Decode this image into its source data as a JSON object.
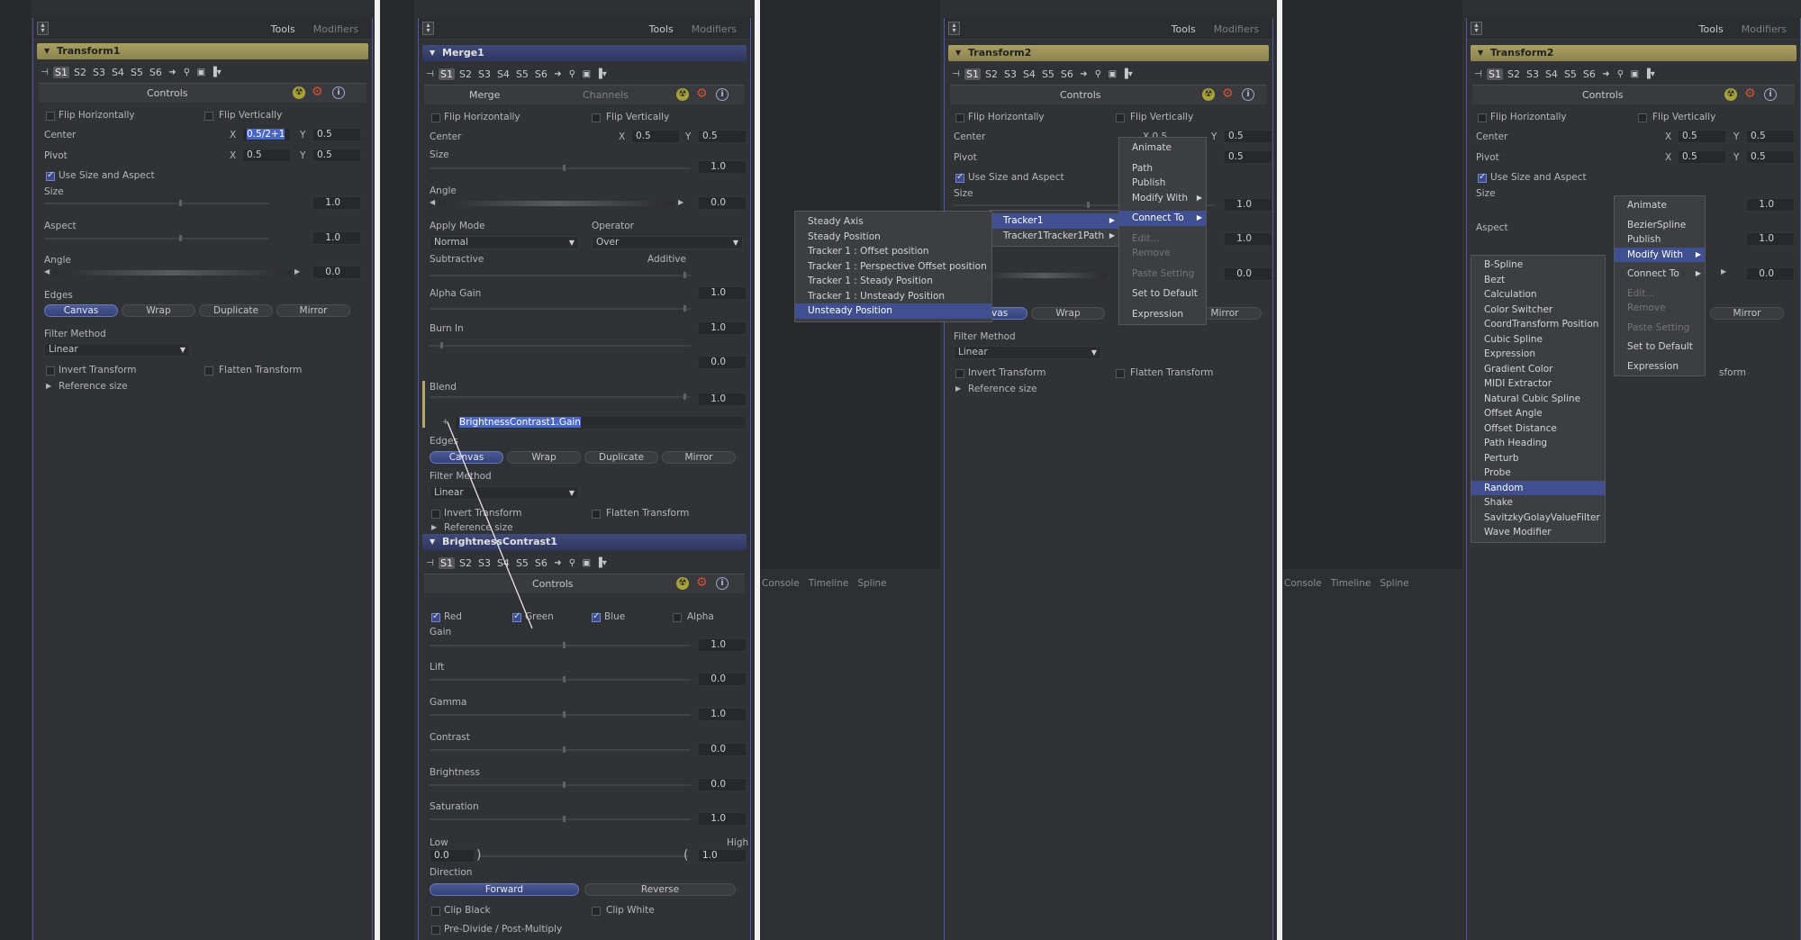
{
  "common": {
    "tab_tools": "Tools",
    "tab_modifiers": "Modifiers",
    "scripts": [
      "S1",
      "S2",
      "S3",
      "S4",
      "S5",
      "S6"
    ],
    "controls": "Controls"
  },
  "p1": {
    "tool": "Transform1",
    "flip_h": "Flip Horizontally",
    "flip_v": "Flip Vertically",
    "center": "Center",
    "center_x": "0.5/2+1",
    "center_y": "0.5",
    "pivot": "Pivot",
    "pivot_x": "0.5",
    "pivot_y": "0.5",
    "use_size": "Use Size and Aspect",
    "size": "Size",
    "size_v": "1.0",
    "aspect": "Aspect",
    "aspect_v": "1.0",
    "angle": "Angle",
    "angle_v": "0.0",
    "edges": "Edges",
    "canvas": "Canvas",
    "wrap": "Wrap",
    "duplicate": "Duplicate",
    "mirror": "Mirror",
    "filter": "Filter Method",
    "filter_v": "Linear",
    "invert": "Invert Transform",
    "flatten": "Flatten Transform",
    "ref": "Reference size",
    "x": "X",
    "y": "Y"
  },
  "p2": {
    "tool": "Merge1",
    "tab_merge": "Merge",
    "tab_channels": "Channels",
    "flip_h": "Flip Horizontally",
    "flip_v": "Flip Vertically",
    "center": "Center",
    "cx": "0.5",
    "cy": "0.5",
    "size": "Size",
    "size_v": "1.0",
    "angle": "Angle",
    "angle_v": "0.0",
    "apply": "Apply Mode",
    "apply_v": "Normal",
    "operator": "Operator",
    "operator_v": "Over",
    "subtractive": "Subtractive",
    "additive": "Additive",
    "sa_v": "1.0",
    "alpha": "Alpha Gain",
    "alpha_v": "1.0",
    "burn": "Burn In",
    "burn_v": "0.0",
    "blend": "Blend",
    "blend_v": "1.0",
    "expr": "BrightnessContrast1.Gain",
    "edges": "Edges",
    "canvas": "Canvas",
    "wrap": "Wrap",
    "duplicate": "Duplicate",
    "mirror": "Mirror",
    "filter": "Filter Method",
    "filter_v": "Linear",
    "invert": "Invert Transform",
    "flatten": "Flatten Transform",
    "ref": "Reference size",
    "x": "X",
    "y": "Y",
    "tool2": "BrightnessContrast1",
    "red": "Red",
    "green": "Green",
    "blue": "Blue",
    "alpha_c": "Alpha",
    "gain": "Gain",
    "gain_v": "1.0",
    "lift": "Lift",
    "lift_v": "0.0",
    "gamma": "Gamma",
    "gamma_v": "1.0",
    "contrast": "Contrast",
    "contrast_v": "0.0",
    "brightness": "Brightness",
    "brightness_v": "0.0",
    "saturation": "Saturation",
    "saturation_v": "1.0",
    "low": "Low",
    "high": "High",
    "low_v": "0.0",
    "high_v": "1.0",
    "direction": "Direction",
    "forward": "Forward",
    "reverse": "Reverse",
    "clip_black": "Clip Black",
    "clip_white": "Clip White",
    "predivide": "Pre-Divide / Post-Multiply"
  },
  "p3": {
    "tool": "Transform2",
    "flip_h": "Flip Horizontally",
    "flip_v": "Flip Vertically",
    "center": "Center",
    "cy": "0.5",
    "pivot": "Pivot",
    "py": "0.5",
    "use_size": "Use Size and Aspect",
    "size": "Size",
    "v1": "1.0",
    "v2": "1.0",
    "v3": "0.0",
    "canvas": "Canvas",
    "wrap": "Wrap",
    "mirror": "Mirror",
    "filter": "Filter Method",
    "filter_v": "Linear",
    "invert": "Invert Transform",
    "flatten": "Flatten Transform",
    "ref": "Reference size",
    "x": "X",
    "y": "Y",
    "x_partial": "X 0.5",
    "menu_main": [
      "Animate",
      "Path",
      "Publish",
      "Modify With",
      "Connect To",
      "Edit...",
      "Remove",
      "Paste Setting",
      "Set to Default",
      "Expression"
    ],
    "menu_tracker": [
      "Tracker1",
      "Tracker1Tracker1Path"
    ],
    "menu_sub": [
      "Steady Axis",
      "Steady Position",
      "Tracker 1 : Offset position",
      "Tracker 1 : Perspective Offset position",
      "Tracker 1 : Steady Position",
      "Tracker 1 : Unsteady Position",
      "Unsteady Position"
    ],
    "bottom": [
      "Console",
      "Timeline",
      "Spline"
    ]
  },
  "p4": {
    "tool": "Transform2",
    "flip_h": "Flip Horizontally",
    "flip_v": "Flip Vertically",
    "center": "Center",
    "cx": "0.5",
    "cy": "0.5",
    "pivot": "Pivot",
    "px": "0.5",
    "py": "0.5",
    "use_size": "Use Size and Aspect",
    "size": "Size",
    "aspect": "Aspect",
    "v1": "1.0",
    "v2": "1.0",
    "v3": "0.0",
    "mirror": "Mirror",
    "x": "X",
    "y": "Y",
    "trail": "sform",
    "menu_main": [
      "Animate",
      "BezierSpline",
      "Publish",
      "Modify With",
      "Connect To",
      "Edit...",
      "Remove",
      "Paste Setting",
      "Set to Default",
      "Expression"
    ],
    "menu_mod": [
      "B-Spline",
      "Bezt",
      "Calculation",
      "Color Switcher",
      "CoordTransform Position",
      "Cubic Spline",
      "Expression",
      "Gradient Color",
      "MIDI Extractor",
      "Natural Cubic Spline",
      "Offset Angle",
      "Offset Distance",
      "Path Heading",
      "Perturb",
      "Probe",
      "Random",
      "Shake",
      "SavitzkyGolayValueFilter",
      "Wave Modifier"
    ],
    "bottom": [
      "Console",
      "Timeline",
      "Spline"
    ]
  }
}
